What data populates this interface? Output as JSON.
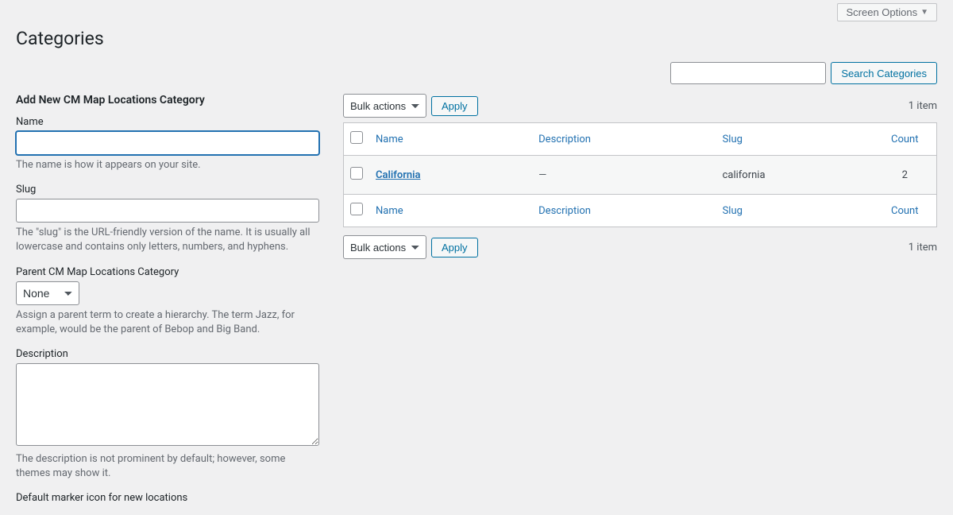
{
  "screen_options_label": "Screen Options",
  "page_title": "Categories",
  "search": {
    "button": "Search Categories"
  },
  "form": {
    "heading": "Add New CM Map Locations Category",
    "name_label": "Name",
    "name_help": "The name is how it appears on your site.",
    "slug_label": "Slug",
    "slug_help": "The \"slug\" is the URL-friendly version of the name. It is usually all lowercase and contains only letters, numbers, and hyphens.",
    "parent_label": "Parent CM Map Locations Category",
    "parent_selected": "None",
    "parent_help": "Assign a parent term to create a hierarchy. The term Jazz, for example, would be the parent of Bebop and Big Band.",
    "desc_label": "Description",
    "desc_help": "The description is not prominent by default; however, some themes may show it.",
    "marker_label": "Default marker icon for new locations"
  },
  "bulk_label": "Bulk actions",
  "apply_label": "Apply",
  "item_count_text": "1 item",
  "columns": {
    "name": "Name",
    "description": "Description",
    "slug": "Slug",
    "count": "Count"
  },
  "rows": [
    {
      "name": "California",
      "description": "—",
      "slug": "california",
      "count": "2"
    }
  ]
}
